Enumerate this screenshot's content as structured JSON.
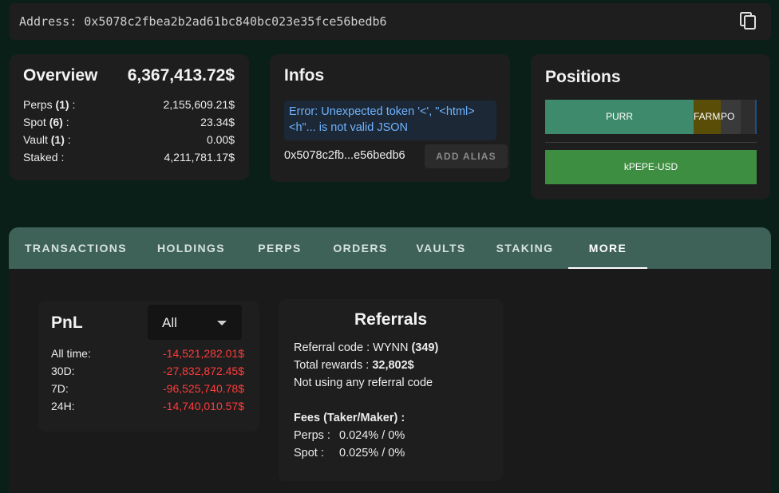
{
  "address_bar": {
    "text": "Address: 0x5078c2fbea2b2ad61bc840bc023e35fce56bedb6",
    "copy_icon": "copy-icon"
  },
  "overview": {
    "title": "Overview",
    "total": "6,367,413.72$",
    "rows": [
      {
        "label": "Perps",
        "count": "(1)",
        "suffix": " :",
        "value": "2,155,609.21$"
      },
      {
        "label": "Spot",
        "count": "(6)",
        "suffix": " :",
        "value": "23.34$"
      },
      {
        "label": "Vault",
        "count": "(1)",
        "suffix": " :",
        "value": "0.00$"
      },
      {
        "label": "Staked",
        "count": "",
        "suffix": " :",
        "value": "4,211,781.17$"
      }
    ]
  },
  "infos": {
    "title": "Infos",
    "error": "Error: Unexpected token '<', \"<html> <h\"... is not valid JSON",
    "short_address": "0x5078c2fb...e56bedb6",
    "alias_button": "ADD ALIAS"
  },
  "positions": {
    "title": "Positions",
    "segments": [
      {
        "label": "PURR",
        "color": "#3e8a6c"
      },
      {
        "label": "FARMA",
        "color": "#5a4d08"
      },
      {
        "label": "PO",
        "color": "#3a3a3a"
      }
    ],
    "secondary": {
      "label": "kPEPE-USD",
      "color": "#3e8e41"
    }
  },
  "tabs": {
    "items": [
      "TRANSACTIONS",
      "HOLDINGS",
      "PERPS",
      "ORDERS",
      "VAULTS",
      "STAKING",
      "MORE"
    ],
    "active_index": 6
  },
  "pnl": {
    "title": "PnL",
    "filter": "All",
    "rows": [
      {
        "label": "All time:",
        "value": "-14,521,282.01$"
      },
      {
        "label": "30D:",
        "value": "-27,832,872.45$"
      },
      {
        "label": "7D:",
        "value": "-96,525,740.78$"
      },
      {
        "label": "24H:",
        "value": "-14,740,010.57$"
      }
    ]
  },
  "referrals": {
    "title": "Referrals",
    "code_label": "Referral code : WYNN ",
    "code_count": "(349)",
    "rewards_label": "Total rewards : ",
    "rewards_value": "32,802$",
    "not_using": "Not using any referral code",
    "fees_title": "Fees (Taker/Maker) :",
    "perps_fee_label": "Perps :",
    "perps_fee": "0.024% / 0%",
    "spot_fee_label": "Spot :",
    "spot_fee": "0.025% / 0%"
  },
  "colors": {
    "background": "#0a1f18",
    "card": "#1e1e1e",
    "tabs_bar": "#3e6257",
    "negative": "#ff3b3b",
    "error_text": "#6fb3ff"
  }
}
